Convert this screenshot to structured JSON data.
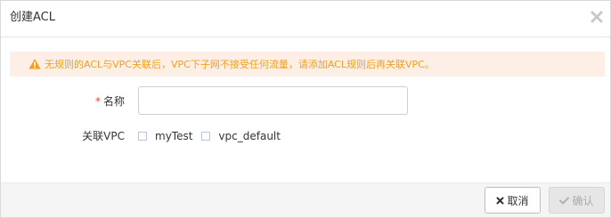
{
  "dialog": {
    "title": "创建ACL"
  },
  "alert": {
    "text": "无规则的ACL与VPC关联后，VPC下子网不接受任何流量，请添加ACL规则后再关联VPC。",
    "icon": "warning-icon",
    "color": "#f0a020",
    "background": "#fdefe6"
  },
  "form": {
    "name_label": "名称",
    "required_mark": "*",
    "name_value": "",
    "vpc_label": "关联VPC",
    "vpc_options": [
      {
        "label": "myTest",
        "checked": false
      },
      {
        "label": "vpc_default",
        "checked": false
      }
    ]
  },
  "footer": {
    "cancel_label": "取消",
    "confirm_label": "确认",
    "cancel_icon": "x-icon",
    "confirm_icon": "check-icon"
  }
}
